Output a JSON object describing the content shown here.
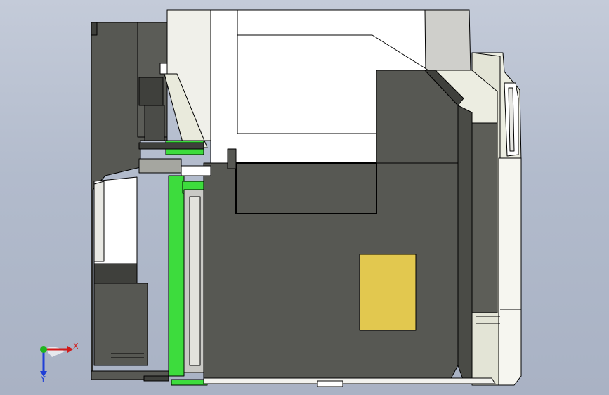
{
  "viewport": {
    "background_top": "#c4cbd9",
    "background_bottom": "#a9b2c4"
  },
  "colors": {
    "body_dark": "#575853",
    "body_darker": "#3f403c",
    "shell_white": "#ffffff",
    "shell_light": "#f2f2ee",
    "shell_cream": "#e8e9dc",
    "shell_gray": "#c9c9c5",
    "green_frame": "#3ddc3d",
    "label_yellow": "#e2c84f",
    "edge": "#000000"
  },
  "triad": {
    "x_label": "X",
    "y_label": "Y",
    "x_color": "#d11a1a",
    "y_color": "#1f3fd6",
    "origin_color": "#1fb51f"
  }
}
